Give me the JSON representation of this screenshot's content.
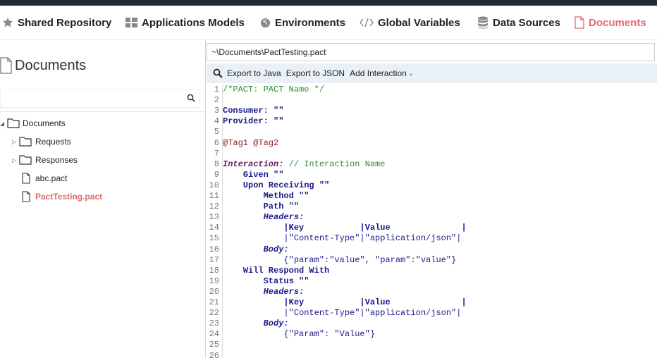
{
  "nav": {
    "items": [
      {
        "label": "Shared Repository",
        "icon": "star-icon",
        "active": false
      },
      {
        "label": "Applications Models",
        "icon": "grid-icon",
        "active": false
      },
      {
        "label": "Environments",
        "icon": "globe-icon",
        "active": false
      },
      {
        "label": "Global  Variables",
        "icon": "code-icon",
        "active": false
      },
      {
        "label": "Data Sources",
        "icon": "database-icon",
        "active": false
      },
      {
        "label": "Documents",
        "icon": "document-icon",
        "active": true
      }
    ],
    "active_color": "#e06b6b"
  },
  "sidebar": {
    "title": "Documents",
    "search": {
      "value": "",
      "placeholder": ""
    },
    "tree": [
      {
        "label": "Documents",
        "type": "folder",
        "expanded": true,
        "level": 0
      },
      {
        "label": "Requests",
        "type": "folder",
        "expanded": false,
        "level": 1
      },
      {
        "label": "Responses",
        "type": "folder",
        "expanded": false,
        "level": 1
      },
      {
        "label": "abc.pact",
        "type": "file",
        "level": 1
      },
      {
        "label": "PactTesting.pact",
        "type": "file",
        "level": 1,
        "active": true
      }
    ]
  },
  "editor": {
    "path": "~\\Documents\\PactTesting.pact",
    "toolbar": {
      "export_java": "Export to Java",
      "export_json": "Export to JSON",
      "add_interaction": "Add Interaction"
    },
    "lines": [
      {
        "n": "1",
        "text": "/*PACT: PACT Name */",
        "style": "comment"
      },
      {
        "n": "2",
        "text": "",
        "style": "plain"
      },
      {
        "n": "3",
        "text": "Consumer: \"\"",
        "style": "kw"
      },
      {
        "n": "4",
        "text": "Provider: \"\"",
        "style": "kw"
      },
      {
        "n": "5",
        "text": "",
        "style": "plain"
      },
      {
        "n": "6",
        "text": "@Tag1 @Tag2",
        "style": "tag"
      },
      {
        "n": "7",
        "text": "",
        "style": "plain"
      },
      {
        "n": "8",
        "text": "Interaction:",
        "style": "inter",
        "rest": " // Interaction Name",
        "rest_style": "comment"
      },
      {
        "n": "9",
        "text": "    Given \"\"",
        "style": "kw"
      },
      {
        "n": "10",
        "text": "    Upon Receiving \"\"",
        "style": "kw"
      },
      {
        "n": "11",
        "text": "        Method \"\"",
        "style": "kw"
      },
      {
        "n": "12",
        "text": "        Path \"\"",
        "style": "kw"
      },
      {
        "n": "13",
        "text": "        Headers:",
        "style": "sub"
      },
      {
        "n": "14",
        "text": "            |Key           |Value              |",
        "style": "kw"
      },
      {
        "n": "15",
        "text": "            |\"Content-Type\"|\"application/json\"|",
        "style": "pipe"
      },
      {
        "n": "16",
        "text": "        Body:",
        "style": "sub"
      },
      {
        "n": "17",
        "text": "            {\"param\":\"value\", \"param\":\"value\"}",
        "style": "pipe"
      },
      {
        "n": "18",
        "text": "    Will Respond With",
        "style": "kw"
      },
      {
        "n": "19",
        "text": "        Status \"\"",
        "style": "kw"
      },
      {
        "n": "20",
        "text": "        Headers:",
        "style": "sub"
      },
      {
        "n": "21",
        "text": "            |Key           |Value              |",
        "style": "kw"
      },
      {
        "n": "22",
        "text": "            |\"Content-Type\"|\"application/json\"|",
        "style": "pipe"
      },
      {
        "n": "23",
        "text": "        Body:",
        "style": "sub"
      },
      {
        "n": "24",
        "text": "            {\"Param\": \"Value\"}",
        "style": "pipe"
      },
      {
        "n": "25",
        "text": "",
        "style": "plain"
      },
      {
        "n": "26",
        "text": "",
        "style": "plain"
      }
    ]
  }
}
